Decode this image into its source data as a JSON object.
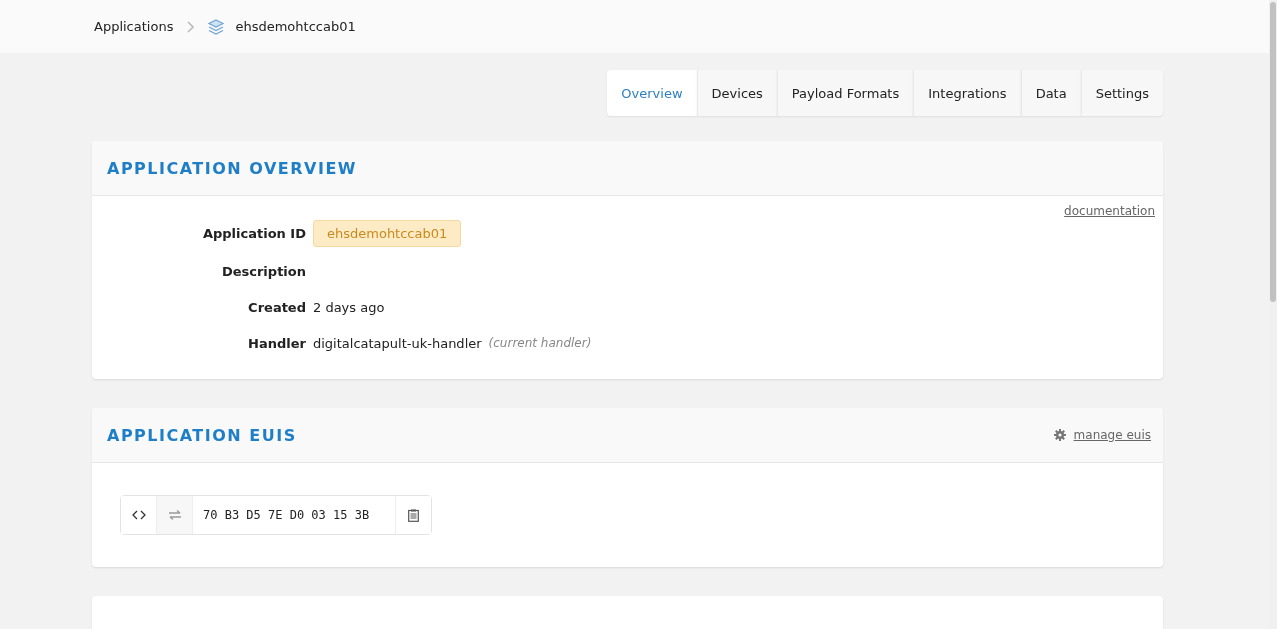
{
  "breadcrumb": [
    {
      "label": "Applications",
      "kind": "link"
    },
    {
      "label": "ehsdemohtccab01",
      "kind": "current"
    }
  ],
  "tabs": [
    {
      "label": "Overview",
      "selected": true
    },
    {
      "label": "Devices",
      "selected": false
    },
    {
      "label": "Payload Formats",
      "selected": false
    },
    {
      "label": "Integrations",
      "selected": false
    },
    {
      "label": "Data",
      "selected": false
    },
    {
      "label": "Settings",
      "selected": false
    }
  ],
  "overview": {
    "title": "APPLICATION OVERVIEW",
    "link": "documentation",
    "rows": [
      {
        "label": "Application ID",
        "kind": "badge",
        "value": "ehsdemohtccab01"
      },
      {
        "label": "Description",
        "kind": "empty"
      },
      {
        "label": "Created",
        "kind": "text",
        "value": "2 days ago"
      },
      {
        "label": "Handler",
        "kind": "text",
        "value": "digitalcatapult-uk-handler",
        "note": "(current handler)"
      }
    ]
  },
  "euis": {
    "title": "APPLICATION EUIS",
    "link": "manage euis",
    "items": [
      {
        "value": "70 B3 D5 7E D0 03 15 3B"
      }
    ]
  }
}
